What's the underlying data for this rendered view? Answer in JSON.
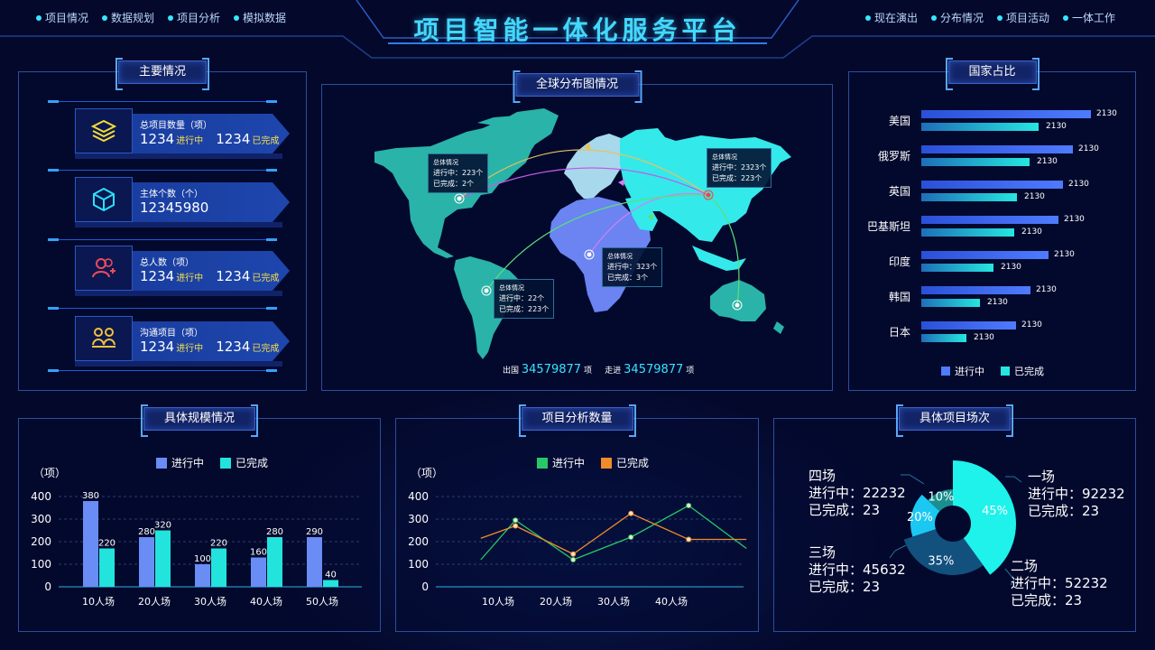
{
  "header": {
    "title": "项目智能一体化服务平台",
    "nav_left": [
      "项目情况",
      "数据规划",
      "项目分析",
      "模拟数据"
    ],
    "nav_right": [
      "现在演出",
      "分布情况",
      "项目活动",
      "一体工作"
    ]
  },
  "main": {
    "title": "主要情况",
    "cards": [
      {
        "icon": "layers-icon",
        "label": "总项目数量（项）",
        "v1": "1234",
        "s1": "进行中",
        "v2": "1234",
        "s2": "已完成"
      },
      {
        "icon": "cube-icon",
        "label": "主体个数（个）",
        "v1": "12345980"
      },
      {
        "icon": "user-add-icon",
        "label": "总人数（项）",
        "v1": "1234",
        "s1": "进行中",
        "v2": "1234",
        "s2": "已完成"
      },
      {
        "icon": "meeting-icon",
        "label": "沟通项目（项）",
        "v1": "1234",
        "s1": "进行中",
        "v2": "1234",
        "s2": "已完成"
      }
    ]
  },
  "map": {
    "title": "全球分布图情况",
    "tips": [
      {
        "title": "总体情况",
        "l1": "进行中：223个",
        "l2": "已完成：2个"
      },
      {
        "title": "总体情况",
        "l1": "进行中：2323个",
        "l2": "已完成：223个"
      },
      {
        "title": "总体情况",
        "l1": "进行中：323个",
        "l2": "已完成：3个"
      },
      {
        "title": "总体情况",
        "l1": "进行中：22个",
        "l2": "已完成：223个"
      }
    ],
    "out_label": "出国",
    "out_value": "34579877",
    "out_unit": "项",
    "in_label": "走进",
    "in_value": "34579877",
    "in_unit": "项",
    "colors": {
      "americas": "#2ab3a8",
      "asia": "#34e9ea",
      "africa": "#6b84f2",
      "europe": "#a8d8ec"
    }
  },
  "country": {
    "title": "国家占比",
    "rows": [
      {
        "name": "美国",
        "a": "2130",
        "b": "2130"
      },
      {
        "name": "俄罗斯",
        "a": "2130",
        "b": "2130"
      },
      {
        "name": "英国",
        "a": "2130",
        "b": "2130"
      },
      {
        "name": "巴基斯坦",
        "a": "2130",
        "b": "2130"
      },
      {
        "name": "印度",
        "a": "2130",
        "b": "2130"
      },
      {
        "name": "韩国",
        "a": "2130",
        "b": "2130"
      },
      {
        "name": "日本",
        "a": "2130",
        "b": "2130"
      }
    ],
    "legend": [
      "进行中",
      "已完成"
    ]
  },
  "scale": {
    "title": "具体规模情况",
    "unit": "（项）"
  },
  "analysis": {
    "title": "项目分析数量",
    "unit": "（项）"
  },
  "session": {
    "title": "具体项目场次",
    "items": [
      {
        "name": "一场",
        "l1": "进行中：92232",
        "l2": "已完成：23"
      },
      {
        "name": "二场",
        "l1": "进行中：52232",
        "l2": "已完成：23"
      },
      {
        "name": "三场",
        "l1": "进行中：45632",
        "l2": "已完成：23"
      },
      {
        "name": "四场",
        "l1": "进行中：22232",
        "l2": "已完成：23"
      }
    ]
  },
  "chart_data": [
    {
      "type": "bar",
      "categories": [
        "10人场",
        "20人场",
        "30人场",
        "40人场",
        "50人场"
      ],
      "series": [
        {
          "name": "进行中",
          "values": [
            380,
            220,
            100,
            130,
            220
          ],
          "labels": [
            "380",
            "280",
            "100",
            "160",
            "290"
          ],
          "color": "#6a8cf5"
        },
        {
          "name": "已完成",
          "values": [
            170,
            250,
            170,
            220,
            30
          ],
          "labels": [
            "220",
            "320",
            "220",
            "280",
            "40"
          ],
          "color": "#22e4dc"
        }
      ],
      "yticks": [
        0,
        100,
        200,
        300,
        400
      ],
      "ylim": [
        0,
        400
      ],
      "ylabel": "（项）"
    },
    {
      "type": "line",
      "categories": [
        "10人场",
        "20人场",
        "30人场",
        "40人场"
      ],
      "x": [
        -0.3,
        0.3,
        1.3,
        2.3,
        3.3,
        4.3
      ],
      "series": [
        {
          "name": "进行中",
          "values": [
            120,
            295,
            120,
            220,
            360,
            170
          ],
          "color": "#28c86a"
        },
        {
          "name": "已完成",
          "values": [
            215,
            270,
            145,
            325,
            210,
            210
          ],
          "color": "#f08c2a"
        }
      ],
      "yticks": [
        0,
        100,
        200,
        300,
        400
      ],
      "ylim": [
        0,
        400
      ],
      "ylabel": "（项）"
    },
    {
      "type": "pie",
      "slices": [
        {
          "name": "一场",
          "label": "45%",
          "value": 40,
          "color": "#1ef2ea",
          "r": 70
        },
        {
          "name": "二场",
          "label": "35%",
          "value": 30,
          "color": "#12507e",
          "r": 57
        },
        {
          "name": "三场",
          "label": "20%",
          "value": 17,
          "color": "#1bc8f2",
          "r": 47
        },
        {
          "name": "四场",
          "label": "10%",
          "value": 13,
          "color": "#1a8f8e",
          "r": 38
        }
      ]
    }
  ]
}
